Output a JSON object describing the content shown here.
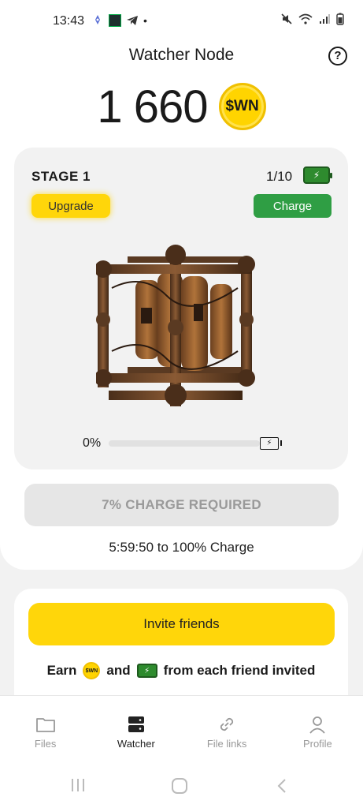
{
  "status_bar": {
    "time": "13:43",
    "dot": "•",
    "left_icons": [
      "rocket-notification-icon",
      "app-notification-icon",
      "telegram-icon"
    ],
    "right_icons": [
      "mute-icon",
      "wifi-icon",
      "signal-icon",
      "battery-icon"
    ]
  },
  "header": {
    "title": "Watcher Node",
    "help_label": "?"
  },
  "balance": {
    "value": "1 660",
    "coin_label": "$WN"
  },
  "node_card": {
    "stage": "STAGE 1",
    "charge_count": "1/10",
    "upgrade_label": "Upgrade",
    "charge_label": "Charge",
    "progress_label": "0%",
    "progress_value": 0
  },
  "charge_required_label": "7% CHARGE REQUIRED",
  "timer_text": "5:59:50 to 100% Charge",
  "invite": {
    "button_label": "Invite friends",
    "earn_prefix": "Earn",
    "earn_and": "and",
    "earn_suffix": "from each friend invited",
    "coin_label": "$WN"
  },
  "bottom_nav": {
    "items": [
      {
        "label": "Files",
        "icon": "folder-icon",
        "active": false
      },
      {
        "label": "Watcher",
        "icon": "server-icon",
        "active": true
      },
      {
        "label": "File links",
        "icon": "link-icon",
        "active": false
      },
      {
        "label": "Profile",
        "icon": "person-icon",
        "active": false
      }
    ]
  },
  "colors": {
    "accent_yellow": "#ffd60a",
    "charge_green": "#2f9e44",
    "disabled_gray": "#e6e6e6"
  }
}
